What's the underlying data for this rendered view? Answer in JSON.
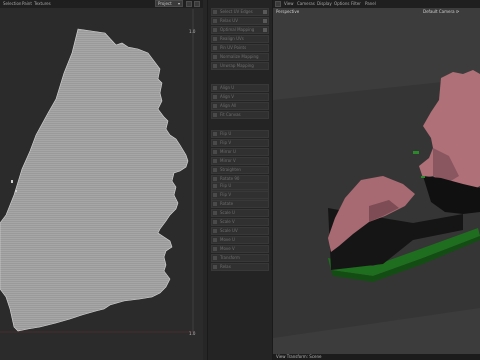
{
  "uv_editor": {
    "menu": [
      "Selection",
      "Paint",
      "Textures"
    ],
    "dropdown": "Project",
    "ruler_top_right": "1.0",
    "ruler_bottom_right": "1.0"
  },
  "tool_panel": {
    "groups": [
      [
        "Select UV Edges",
        "Relax UV",
        "Optimal Mapping",
        "Realign UVs",
        "Pin UV Points",
        "Normalize Mapping",
        "Unwrap Mapping"
      ],
      [
        "Align U",
        "Align V",
        "Align All",
        "Fit Canvas"
      ],
      [
        "Flip U",
        "Flip V",
        "Mirror U",
        "Mirror V",
        "Straighten",
        "Rotate 90",
        "Stitch Points",
        "Weld Points"
      ],
      [
        "Flip U",
        "Flip V",
        "Rotate",
        "Scale U",
        "Scale V",
        "Scale UV",
        "Move U",
        "Move V",
        "Transform",
        "Relax"
      ]
    ]
  },
  "viewport": {
    "menu": [
      "View",
      "Cameras",
      "Display",
      "Options",
      "Filter",
      "Panel"
    ],
    "label_perspective": "Perspective",
    "label_camera": "Default Camera ⟳",
    "label_object": "Maps ⟳",
    "bottom": "View Transform: Scene"
  },
  "colors": {
    "uv_fill": "#a4a4a4",
    "mesh_pink": "#b07078",
    "mesh_green": "#1f6e1f"
  }
}
